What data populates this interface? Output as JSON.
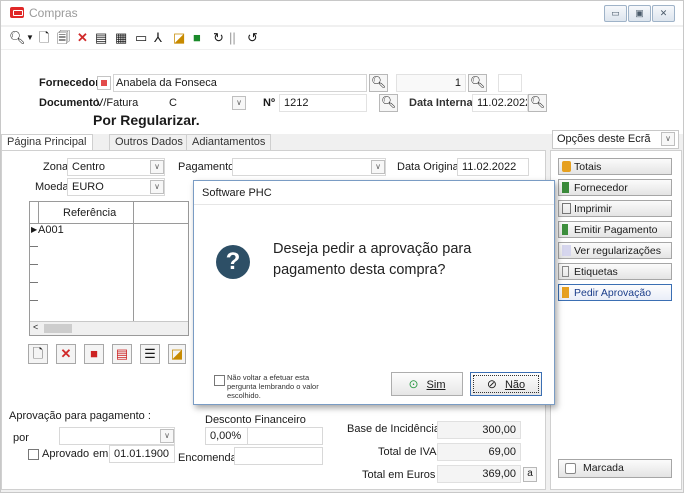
{
  "window": {
    "title": "Compras",
    "btn_min": "▭",
    "btn_max": "▣",
    "btn_close": "✕"
  },
  "toolbar": {
    "icons": [
      "search-icon",
      "chevron-down-icon",
      "new-doc-icon",
      "copy-doc-icon",
      "delete-icon",
      "edit-icon",
      "grid-icon",
      "card-icon",
      "tree-icon",
      "search-doc-icon",
      "folder-icon",
      "refresh-icon",
      "undo-icon"
    ]
  },
  "header": {
    "fornecedor_label": "Fornecedor",
    "fornecedor_value": "Anabela da Fonseca",
    "fornecedor_num": "1",
    "documento_label": "Documento",
    "documento_value": "V/Fatura",
    "documento_serie": "C",
    "numero_label": "Nº",
    "numero_value": "1212",
    "data_interna_label": "Data Interna",
    "data_interna_value": "11.02.2022",
    "status": "Por Regularizar."
  },
  "tabs": [
    "Página Principal",
    "Outros Dados",
    "Adiantamentos"
  ],
  "main": {
    "zona_label": "Zona",
    "zona_value": "Centro",
    "pagamento_label": "Pagamento",
    "pagamento_value": "",
    "data_original_label": "Data Original",
    "data_original_value": "11.02.2022",
    "moeda_label": "Moeda",
    "moeda_value": "EURO",
    "grid_header": "Referência",
    "grid_rows": [
      "A001"
    ],
    "aprovacao_label": "Aprovação para pagamento :",
    "por_label": "por",
    "aprovado_label": "Aprovado",
    "em_label": "em",
    "aprovado_date": "01.01.1900",
    "desconto_label": "Desconto Financeiro",
    "desconto_value": "0,00%",
    "encomenda_label": "Encomenda",
    "base_label": "Base de Incidência",
    "base_value": "300,00",
    "iva_label": "Total de IVA",
    "iva_value": "69,00",
    "total_label": "Total em Euros",
    "total_value": "369,00",
    "total_btn": "a"
  },
  "side": {
    "opcoes_label": "Opções deste Ecrã",
    "buttons": [
      "Totais",
      "Fornecedor",
      "Imprimir",
      "Emitir Pagamento",
      "Ver regularizações",
      "Etiquetas",
      "Pedir Aprovação"
    ],
    "marcada_label": "Marcada"
  },
  "dialog": {
    "title": "Software PHC",
    "message": "Deseja pedir a aprovação para pagamento desta compra?",
    "checkbox_label": "Não voltar a efetuar esta pergunta lembrando o valor escolhido.",
    "sim_label": "Sim",
    "nao_label": "Não",
    "icon_glyph": "?"
  },
  "colors": {
    "accent": "#e02828",
    "dialog_icon": "#2d4f66",
    "focus": "#3b6fb3"
  }
}
